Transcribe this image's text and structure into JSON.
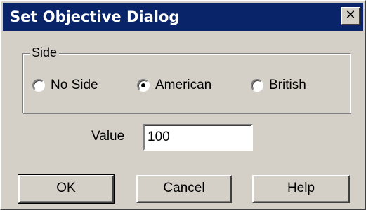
{
  "window": {
    "title": "Set Objective Dialog",
    "close_glyph": "✕"
  },
  "side_group": {
    "label": "Side",
    "options": [
      {
        "label": "No Side",
        "selected": false
      },
      {
        "label": "American",
        "selected": true
      },
      {
        "label": "British",
        "selected": false
      }
    ]
  },
  "value_field": {
    "label": "Value",
    "value": "100"
  },
  "buttons": {
    "ok": "OK",
    "cancel": "Cancel",
    "help": "Help"
  },
  "colors": {
    "title_bar": "#0a246a",
    "face": "#d4d0c8"
  }
}
